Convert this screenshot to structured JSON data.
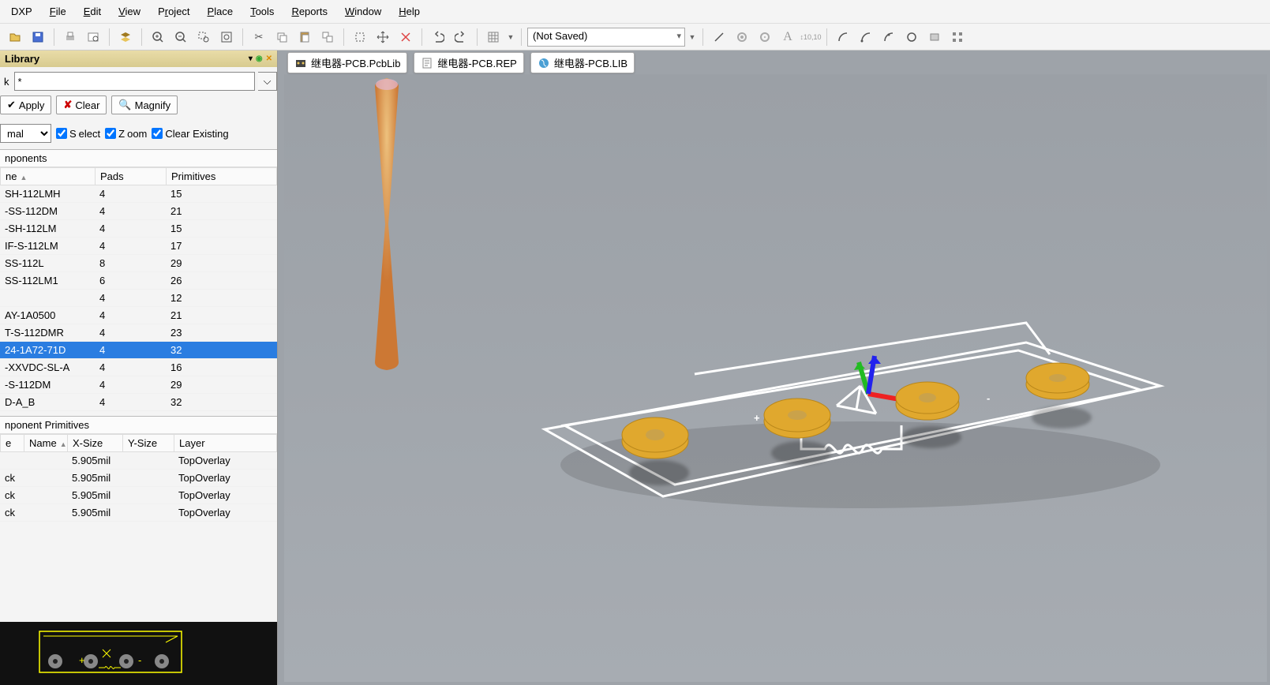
{
  "menu": {
    "items": [
      {
        "label": "DXP",
        "u": ""
      },
      {
        "label": "File",
        "u": "F"
      },
      {
        "label": "Edit",
        "u": "E"
      },
      {
        "label": "View",
        "u": "V"
      },
      {
        "label": "Project",
        "u": "r"
      },
      {
        "label": "Place",
        "u": "P"
      },
      {
        "label": "Tools",
        "u": "T"
      },
      {
        "label": "Reports",
        "u": "R"
      },
      {
        "label": "Window",
        "u": "W"
      },
      {
        "label": "Help",
        "u": "H"
      }
    ]
  },
  "toolbar": {
    "config_label": "(Not Saved)"
  },
  "panel": {
    "title": "Library",
    "mask_label": "k",
    "mask_value": "*",
    "apply": "Apply",
    "clear": "Clear",
    "magnify": "Magnify",
    "normal": "mal",
    "select": "Select",
    "zoom": "Zoom",
    "clear_existing": "Clear Existing"
  },
  "components": {
    "section": "nponents",
    "cols": [
      "ne",
      "Pads",
      "Primitives"
    ],
    "rows": [
      {
        "n": "SH-112LMH",
        "p": "4",
        "r": "15"
      },
      {
        "n": "-SS-112DM",
        "p": "4",
        "r": "21"
      },
      {
        "n": "-SH-112LM",
        "p": "4",
        "r": "15"
      },
      {
        "n": "IF-S-112LM",
        "p": "4",
        "r": "17"
      },
      {
        "n": "SS-112L",
        "p": "8",
        "r": "29"
      },
      {
        "n": "SS-112LM1",
        "p": "6",
        "r": "26"
      },
      {
        "n": "",
        "p": "4",
        "r": "12"
      },
      {
        "n": "AY-1A0500",
        "p": "4",
        "r": "21"
      },
      {
        "n": "T-S-112DMR",
        "p": "4",
        "r": "23"
      },
      {
        "n": "24-1A72-71D",
        "p": "4",
        "r": "32",
        "sel": true
      },
      {
        "n": "-XXVDC-SL-A",
        "p": "4",
        "r": "16"
      },
      {
        "n": "-S-112DM",
        "p": "4",
        "r": "29"
      },
      {
        "n": "D-A_B",
        "p": "4",
        "r": "32"
      }
    ]
  },
  "primitives": {
    "section": "nponent Primitives",
    "cols": [
      "e",
      "Name",
      "X-Size",
      "Y-Size",
      "Layer"
    ],
    "rows": [
      {
        "t": "",
        "n": "",
        "x": "5.905mil",
        "y": "",
        "l": "TopOverlay"
      },
      {
        "t": "ck",
        "n": "",
        "x": "5.905mil",
        "y": "",
        "l": "TopOverlay"
      },
      {
        "t": "ck",
        "n": "",
        "x": "5.905mil",
        "y": "",
        "l": "TopOverlay"
      },
      {
        "t": "ck",
        "n": "",
        "x": "5.905mil",
        "y": "",
        "l": "TopOverlay"
      }
    ]
  },
  "tabs": [
    {
      "label": "继电器-PCB.PcbLib",
      "icon": "pcb"
    },
    {
      "label": "继电器-PCB.REP",
      "icon": "doc"
    },
    {
      "label": "继电器-PCB.LIB",
      "icon": "ie"
    }
  ]
}
